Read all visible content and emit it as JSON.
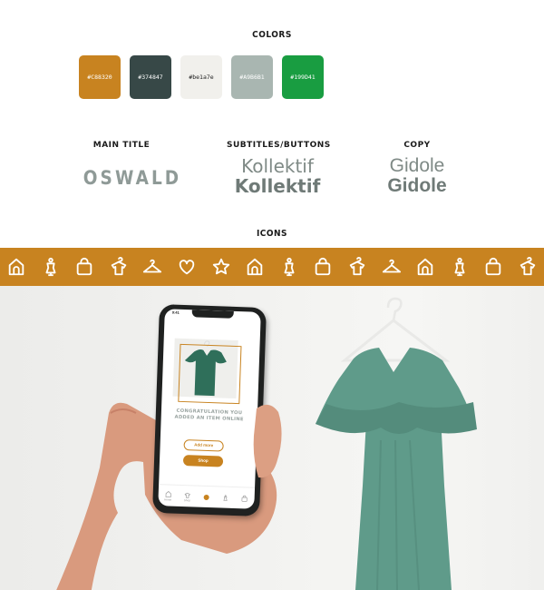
{
  "sections": {
    "colors": "COLORS",
    "main_title": "MAIN TITLE",
    "subtitles_buttons": "SUBTITLES/BUTTONS",
    "copy": "COPY",
    "icons": "ICONS"
  },
  "swatches": [
    {
      "hex": "#C88320",
      "label": "#C88320",
      "text_color": "#ffffff"
    },
    {
      "hex": "#374847",
      "label": "#374847",
      "text_color": "#ffffff"
    },
    {
      "hex": "#be1a7e",
      "label": "#be1a7e",
      "text_color": "#222222",
      "display_color": "#f1f0ec"
    },
    {
      "hex": "#A9B6B1",
      "label": "#A9B6B1",
      "text_color": "#ffffff"
    },
    {
      "hex": "#199D41",
      "label": "#199D41",
      "text_color": "#ffffff"
    }
  ],
  "typography": {
    "main_title_sample": "OSWALD",
    "subtitle_regular": "Kollektif",
    "subtitle_bold": "Kollektif",
    "copy_regular": "Gidole",
    "copy_bold": "Gidole"
  },
  "icons": [
    "house-icon",
    "mannequin-icon",
    "shopping-bag-icon",
    "shirt-icon",
    "hanger-icon",
    "heart-icon",
    "star-icon",
    "house-icon",
    "mannequin-icon",
    "shopping-bag-icon",
    "shirt-icon",
    "hanger-icon",
    "house-icon",
    "mannequin-icon",
    "shopping-bag-icon",
    "shirt-icon"
  ],
  "accent_color": "#C88320",
  "phone_app": {
    "status_time": "9:41",
    "message": "CONGRATULATION YOU ADDED AN ITEM ONLINE",
    "add_more_label": "Add more",
    "shop_label": "Shop",
    "tabs": [
      "Home",
      "Shop",
      "",
      "",
      ""
    ]
  }
}
